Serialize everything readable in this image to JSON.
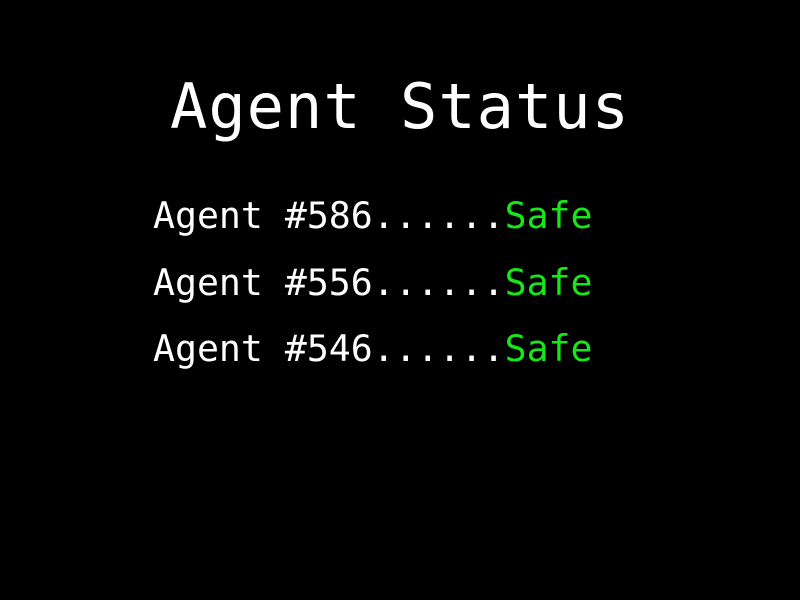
{
  "title": "Agent Status",
  "agents": [
    {
      "label": "Agent #586",
      "leader": "......",
      "status": "Safe"
    },
    {
      "label": "Agent #556",
      "leader": "......",
      "status": "Safe"
    },
    {
      "label": "Agent #546",
      "leader": "......",
      "status": "Safe"
    }
  ],
  "colors": {
    "background": "#000000",
    "text": "#ffffff",
    "status_safe": "#19e619"
  }
}
